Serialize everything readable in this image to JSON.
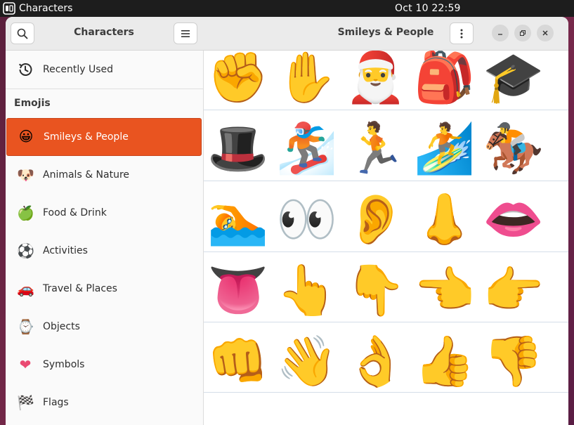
{
  "topbar": {
    "app_name": "Characters",
    "clock": "Oct 10  22:59"
  },
  "sidebar": {
    "title": "Characters",
    "recent_label": "Recently Used",
    "section_title": "Emojis",
    "categories": [
      {
        "label": "Smileys & People",
        "icon": "smiley-icon",
        "glyph": "😀"
      },
      {
        "label": "Animals & Nature",
        "icon": "dog-icon",
        "glyph": "🐶"
      },
      {
        "label": "Food & Drink",
        "icon": "apple-icon",
        "glyph": "🍏"
      },
      {
        "label": "Activities",
        "icon": "soccer-ball-icon",
        "glyph": "⚽"
      },
      {
        "label": "Travel & Places",
        "icon": "car-icon",
        "glyph": "🚗"
      },
      {
        "label": "Objects",
        "icon": "watch-icon",
        "glyph": "⌚"
      },
      {
        "label": "Symbols",
        "icon": "heart-icon",
        "glyph": "❤"
      },
      {
        "label": "Flags",
        "icon": "checkered-flag-icon",
        "glyph": "🏁"
      }
    ],
    "selected_index": 0
  },
  "main": {
    "title": "Smileys & People",
    "accent_color": "#e95420",
    "emojis": [
      {
        "name": "raised-fist",
        "glyph": "✊"
      },
      {
        "name": "raised-hand",
        "glyph": "✋"
      },
      {
        "name": "santa-claus",
        "glyph": "🎅"
      },
      {
        "name": "backpack",
        "glyph": "🎒"
      },
      {
        "name": "graduation-cap",
        "glyph": "🎓"
      },
      {
        "name": "top-hat",
        "glyph": "🎩"
      },
      {
        "name": "snowboarder",
        "glyph": "🏂"
      },
      {
        "name": "person-running",
        "glyph": "🏃"
      },
      {
        "name": "person-surfing",
        "glyph": "🏄"
      },
      {
        "name": "horse-racing",
        "glyph": "🏇"
      },
      {
        "name": "person-swimming",
        "glyph": "🏊"
      },
      {
        "name": "eyes",
        "glyph": "👀"
      },
      {
        "name": "ear",
        "glyph": "👂"
      },
      {
        "name": "nose",
        "glyph": "👃"
      },
      {
        "name": "mouth",
        "glyph": "👄"
      },
      {
        "name": "tongue",
        "glyph": "👅"
      },
      {
        "name": "backhand-index-pointing-up",
        "glyph": "👆"
      },
      {
        "name": "backhand-index-pointing-down",
        "glyph": "👇"
      },
      {
        "name": "backhand-index-pointing-left",
        "glyph": "👈"
      },
      {
        "name": "backhand-index-pointing-right",
        "glyph": "👉"
      },
      {
        "name": "oncoming-fist",
        "glyph": "👊"
      },
      {
        "name": "waving-hand",
        "glyph": "👋"
      },
      {
        "name": "ok-hand",
        "glyph": "👌"
      },
      {
        "name": "thumbs-up",
        "glyph": "👍"
      },
      {
        "name": "thumbs-down",
        "glyph": "👎"
      }
    ]
  }
}
